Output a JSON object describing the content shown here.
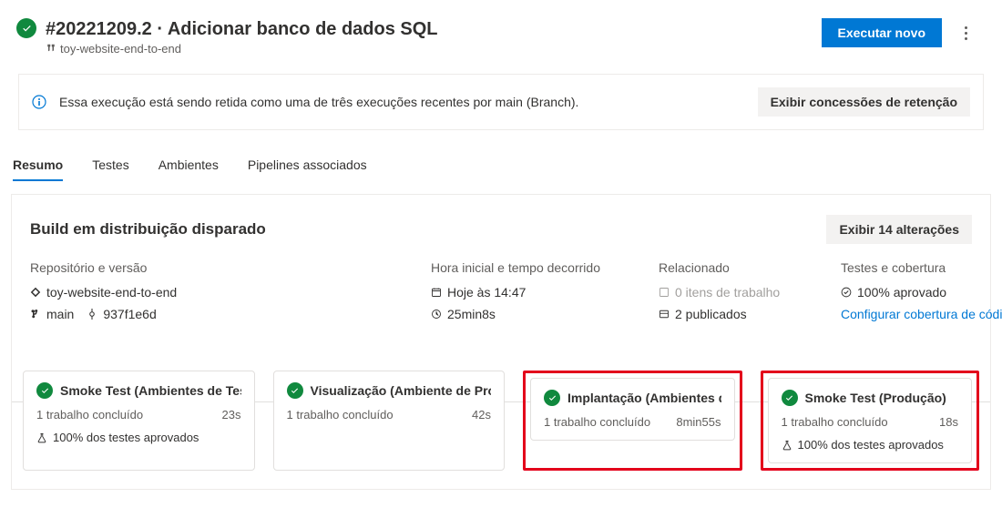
{
  "header": {
    "title": "#20221209.2 · Adicionar banco de dados SQL",
    "pipeline_label": "toy-website-end-to-end",
    "run_button": "Executar novo"
  },
  "retention": {
    "message": "Essa execução está sendo retida como uma de três execuções recentes por main (Branch).",
    "button": "Exibir concessões de retenção"
  },
  "tabs": [
    {
      "label": "Resumo",
      "active": true
    },
    {
      "label": "Testes"
    },
    {
      "label": "Ambientes"
    },
    {
      "label": "Pipelines associados"
    }
  ],
  "summary": {
    "heading": "Build em distribuição disparado",
    "changes_button": "Exibir 14 alterações",
    "repo": {
      "label": "Repositório e versão",
      "name": "toy-website-end-to-end",
      "branch": "main",
      "commit": "937f1e6d"
    },
    "time": {
      "label": "Hora inicial e tempo decorrido",
      "start": "Hoje às 14:47",
      "duration": "25min8s"
    },
    "related": {
      "label": "Relacionado",
      "workitems": "0 itens de trabalho",
      "published": "2 publicados"
    },
    "tests": {
      "label": "Testes e cobertura",
      "approved": "100% aprovado",
      "coverage_link": "Configurar cobertura de código"
    }
  },
  "stages": [
    {
      "title": "Smoke Test (Ambientes de Teste",
      "jobs": "1 trabalho concluído",
      "duration": "23s",
      "tests": "100% dos testes aprovados",
      "highlight": false,
      "show_tests": true
    },
    {
      "title": "Visualização (Ambiente de Pro ...",
      "jobs": "1 trabalho concluído",
      "duration": "42s",
      "highlight": false,
      "show_tests": false
    },
    {
      "title": "Implantação (Ambientes de P...",
      "jobs": "1 trabalho concluído",
      "duration": "8min55s",
      "highlight": true,
      "show_tests": false
    },
    {
      "title": "Smoke Test (Produção)",
      "jobs": "1 trabalho concluído",
      "duration": "18s",
      "tests": "100% dos testes aprovados",
      "highlight": true,
      "show_tests": true
    }
  ]
}
